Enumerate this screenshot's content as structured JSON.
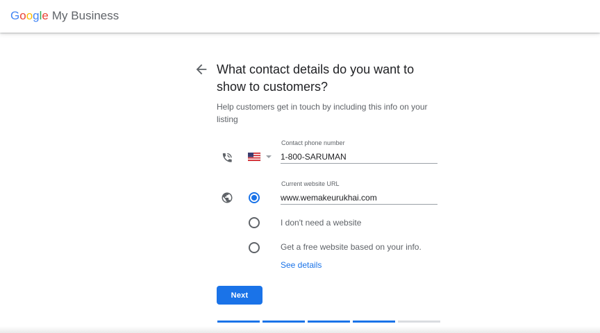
{
  "header": {
    "logo_letters": [
      {
        "char": "G",
        "color": "#4285F4"
      },
      {
        "char": "o",
        "color": "#EA4335"
      },
      {
        "char": "o",
        "color": "#FBBC05"
      },
      {
        "char": "g",
        "color": "#4285F4"
      },
      {
        "char": "l",
        "color": "#34A853"
      },
      {
        "char": "e",
        "color": "#EA4335"
      }
    ],
    "product_name": "My Business"
  },
  "page": {
    "back_icon": "arrow-left-icon",
    "title": "What contact details do you want to show to customers?",
    "subtitle": "Help customers get in touch by including this info on your listing"
  },
  "phone": {
    "icon": "phone-icon",
    "country_flag": "us-flag-icon",
    "dropdown_icon": "caret-down-icon",
    "label": "Contact phone number",
    "value": "1-800-SARUMAN"
  },
  "website": {
    "icon": "globe-icon",
    "label": "Current website URL",
    "value": "www.wemakeurukhai.com",
    "options": [
      {
        "label": "",
        "selected": true
      },
      {
        "label": "I don't need a website",
        "selected": false
      },
      {
        "label": "Get a free website based on your info.",
        "selected": false
      }
    ],
    "see_details": "See details"
  },
  "actions": {
    "next_label": "Next"
  },
  "progress": {
    "total_steps": 5,
    "completed_steps": 4
  },
  "colors": {
    "accent": "#1a73e8",
    "text_primary": "#202124",
    "text_secondary": "#5f6368",
    "progress_inactive": "#dadce0"
  }
}
